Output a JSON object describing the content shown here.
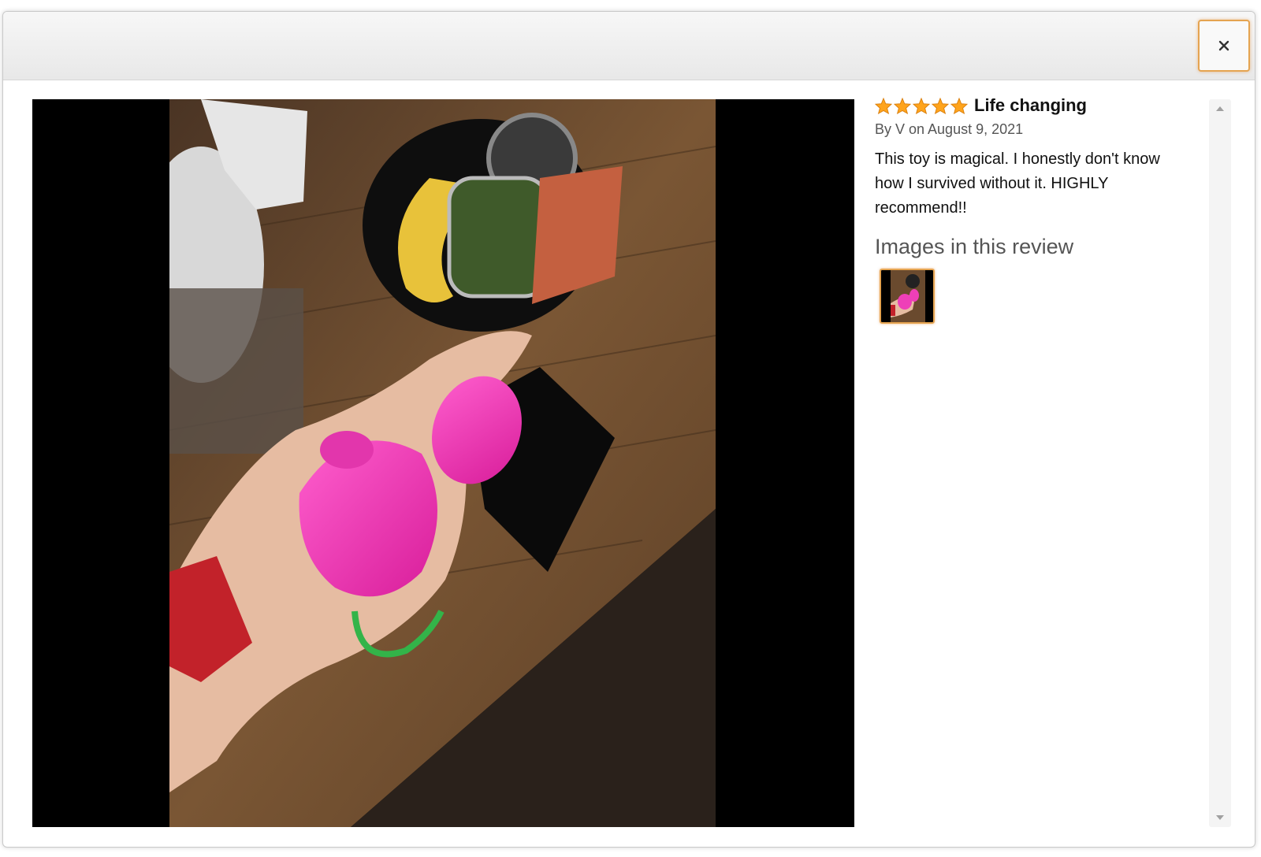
{
  "modal": {
    "close_icon": "close-icon"
  },
  "review": {
    "rating": 5,
    "rating_max": 5,
    "star_color": "#ffa41c",
    "title": "Life changing",
    "byline": "By V on August 9, 2021",
    "body": "This toy is magical. I honestly don't know how I survived without it. HIGHLY recommend!!",
    "images_heading": "Images in this review",
    "thumbnail_count": 1
  },
  "scrollbar": {
    "up_icon": "chevron-up-icon",
    "down_icon": "chevron-down-icon"
  },
  "colors": {
    "accent_border": "#e5a451",
    "header_bg": "#eeeeee"
  }
}
